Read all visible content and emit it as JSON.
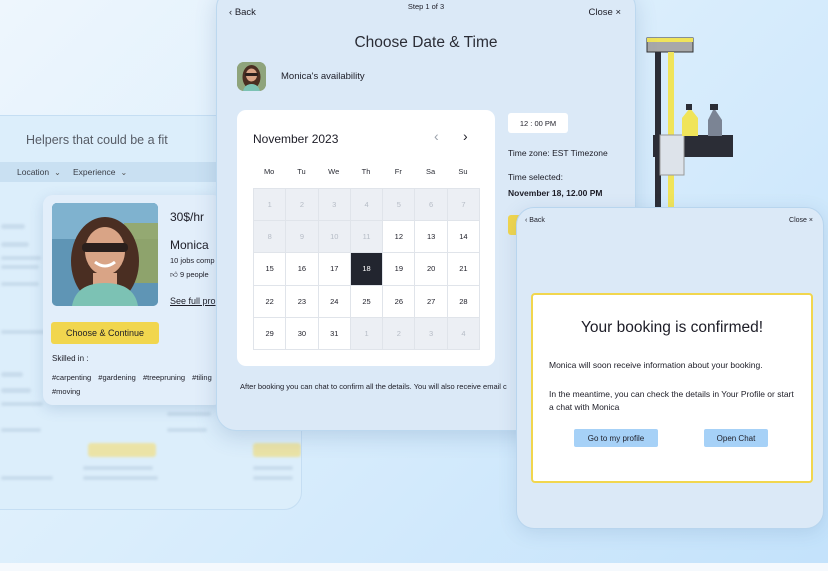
{
  "helpers_panel": {
    "title": "Helpers that could be a fit",
    "filters": [
      {
        "label": "Location"
      },
      {
        "label": "Experience"
      }
    ],
    "card": {
      "price": "30$/hr",
      "name": "Monica",
      "jobs": "10 jobs comp",
      "likes": "9 people",
      "profile_link": "See full pro",
      "choose_button": "Choose & Continue",
      "skilled_label": "Skilled in :",
      "tags": [
        "#carpenting",
        "#gardening",
        "#treepruning",
        "#tiling",
        "#moving"
      ]
    },
    "blurred": {
      "choose_button": "Choose & Continue",
      "skills": "Skills in :"
    }
  },
  "calendar_panel": {
    "back_label": "Back",
    "step_label": "Step 1 of 3",
    "close_label": "Close",
    "title": "Choose Date & Time",
    "availability_label": "Monica's availability",
    "month": "November 2023",
    "weekdays": [
      "Mo",
      "Tu",
      "We",
      "Th",
      "Fr",
      "Sa",
      "Su"
    ],
    "days": [
      {
        "d": "1",
        "s": "muted"
      },
      {
        "d": "2",
        "s": "muted"
      },
      {
        "d": "3",
        "s": "muted"
      },
      {
        "d": "4",
        "s": "muted"
      },
      {
        "d": "5",
        "s": "muted"
      },
      {
        "d": "6",
        "s": "muted"
      },
      {
        "d": "7",
        "s": "muted"
      },
      {
        "d": "8",
        "s": "muted"
      },
      {
        "d": "9",
        "s": "muted"
      },
      {
        "d": "10",
        "s": "muted"
      },
      {
        "d": "11",
        "s": "muted"
      },
      {
        "d": "12",
        "s": ""
      },
      {
        "d": "13",
        "s": ""
      },
      {
        "d": "14",
        "s": ""
      },
      {
        "d": "15",
        "s": ""
      },
      {
        "d": "16",
        "s": ""
      },
      {
        "d": "17",
        "s": ""
      },
      {
        "d": "18",
        "s": "selected"
      },
      {
        "d": "19",
        "s": ""
      },
      {
        "d": "20",
        "s": ""
      },
      {
        "d": "21",
        "s": ""
      },
      {
        "d": "22",
        "s": ""
      },
      {
        "d": "23",
        "s": ""
      },
      {
        "d": "24",
        "s": ""
      },
      {
        "d": "25",
        "s": ""
      },
      {
        "d": "26",
        "s": ""
      },
      {
        "d": "27",
        "s": ""
      },
      {
        "d": "28",
        "s": ""
      },
      {
        "d": "29",
        "s": ""
      },
      {
        "d": "30",
        "s": ""
      },
      {
        "d": "31",
        "s": ""
      },
      {
        "d": "1",
        "s": "muted"
      },
      {
        "d": "2",
        "s": "muted"
      },
      {
        "d": "3",
        "s": "muted"
      },
      {
        "d": "4",
        "s": "muted"
      }
    ],
    "time_chip": "12 : 00 PM",
    "timezone": "Time zone: EST Timezone",
    "time_selected_label": "Time selected:",
    "time_selected_value": "November 18, 12.00 PM",
    "footer": "After booking you can chat to confirm all the details. You will also receive email c"
  },
  "confirm_panel": {
    "back_label": "Back",
    "close_label": "Close",
    "title": "Your booking is confirmed!",
    "text1": "Monica will soon receive information about your booking.",
    "text2": "In the meantime, you can check the details in Your Profile or start a chat with Monica",
    "profile_button": "Go to my profile",
    "chat_button": "Open Chat"
  },
  "colors": {
    "accent_yellow": "#f1d64e",
    "selected_day": "#22252f",
    "button_blue": "#a6d1f7"
  }
}
